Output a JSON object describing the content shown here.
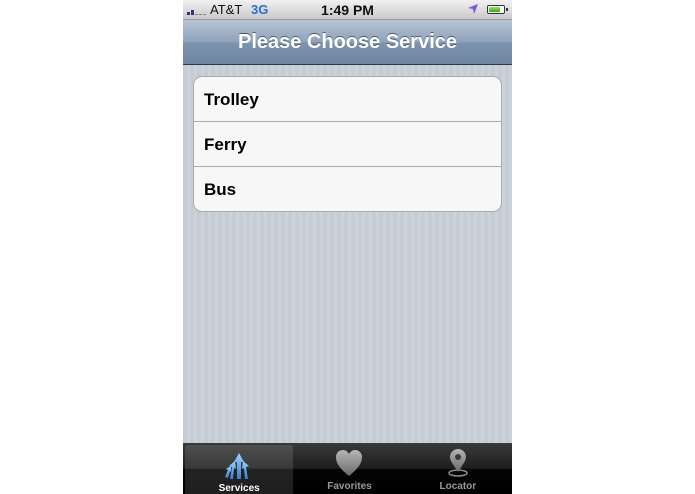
{
  "status_bar": {
    "carrier": "AT&T",
    "network": "3G",
    "time": "1:49 PM",
    "location_icon": "location-arrow-icon",
    "battery_icon": "battery-icon",
    "battery_level": 0.8
  },
  "nav_bar": {
    "title": "Please Choose Service"
  },
  "services": [
    {
      "label": "Trolley"
    },
    {
      "label": "Ferry"
    },
    {
      "label": "Bus"
    }
  ],
  "tab_bar": {
    "tabs": [
      {
        "label": "Services",
        "icon": "services-arrows-icon",
        "selected": true
      },
      {
        "label": "Favorites",
        "icon": "heart-icon",
        "selected": false
      },
      {
        "label": "Locator",
        "icon": "locator-pin-icon",
        "selected": false
      }
    ]
  },
  "colors": {
    "nav_bar": "#8fa3bb",
    "background": "#c5ccd4",
    "selected_icon": "#5aa3e0",
    "unselected_icon": "#8c8c8c"
  }
}
